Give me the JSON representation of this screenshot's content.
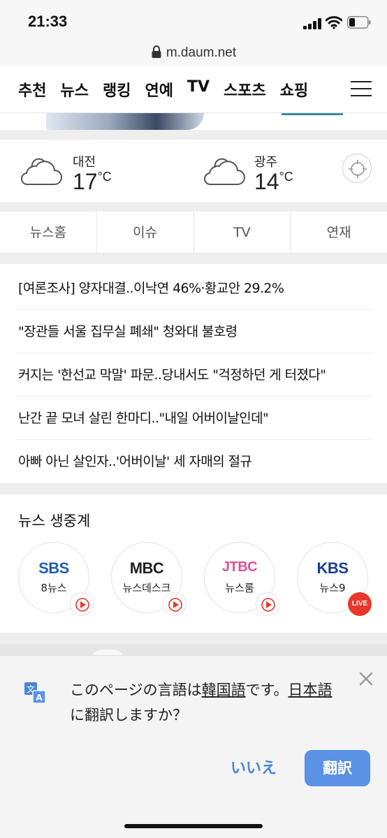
{
  "status_bar": {
    "time": "21:33"
  },
  "browser": {
    "url": "m.daum.net"
  },
  "nav": {
    "items": [
      "추천",
      "뉴스",
      "랭킹",
      "연예",
      "TV",
      "스포츠",
      "쇼핑"
    ]
  },
  "weather": {
    "locations": [
      {
        "city": "대전",
        "temp": "17",
        "unit": "°C"
      },
      {
        "city": "광주",
        "temp": "14",
        "unit": "°C"
      }
    ]
  },
  "tabs": [
    "뉴스홈",
    "이슈",
    "TV",
    "연재"
  ],
  "news": [
    "[여론조사] 양자대결..이낙연 46%·황교안 29.2%",
    "\"장관들 서울 집무실 폐쇄\" 청와대 불호령",
    "커지는 '한선교 막말' 파문..당내서도 \"걱정하던 게 터졌다\"",
    "난간 끝 모녀 살린 한마디..\"내일 어버이날인데\"",
    "아빠 아닌 살인자..'어버이날' 세 자매의 절규"
  ],
  "live": {
    "title": "뉴스 생중계",
    "broadcasters": [
      {
        "logo": "SBS",
        "program": "8뉴스",
        "color": "#1f5fb0"
      },
      {
        "logo": "MBC",
        "program": "뉴스데스크",
        "color": "#222222"
      },
      {
        "logo": "JTBC",
        "program": "뉴스룸",
        "color": "#d9539a"
      },
      {
        "logo": "KBS",
        "program": "뉴스9",
        "color": "#1c3f8f"
      }
    ],
    "live_badge": "LIVE"
  },
  "translate": {
    "msg_1": "このページの言語は",
    "msg_2": "韓国語",
    "msg_3": "です。",
    "msg_4": "日本語",
    "msg_5": "に翻訳しますか？",
    "no_label": "いいえ",
    "yes_label": "翻訳"
  }
}
